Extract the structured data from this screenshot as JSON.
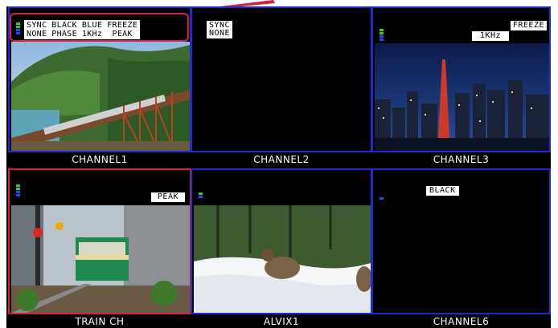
{
  "colors": {
    "cell_border": "#1d2bd6",
    "active_border": "#d8203a",
    "callout": "#d8203a",
    "meter_top": "#2ecc40",
    "meter_bottom": "#1d4bff"
  },
  "status_panel": {
    "headers": [
      "SYNC",
      "BLACK",
      "BLUE",
      "FREEZE"
    ],
    "values": [
      "NONE",
      "PHASE",
      "1KHz",
      "PEAK"
    ]
  },
  "channels": [
    {
      "label": "CHANNEL1",
      "scene": "mountain-railway-bridge"
    },
    {
      "label": "CHANNEL2",
      "alert_line1": "SYNC",
      "alert_line2": "NONE"
    },
    {
      "label": "CHANNEL3",
      "alert_freeze": "FREEZE",
      "alert_tone": "1KHz",
      "scene": "city-night-skyline"
    },
    {
      "label": "TRAIN CH",
      "alert_peak": "PEAK",
      "scene": "streetcar-station"
    },
    {
      "label": "ALVIX1",
      "scene": "ducks-in-snow"
    },
    {
      "label": "CHANNEL6",
      "alert_black": "BLACK"
    }
  ]
}
